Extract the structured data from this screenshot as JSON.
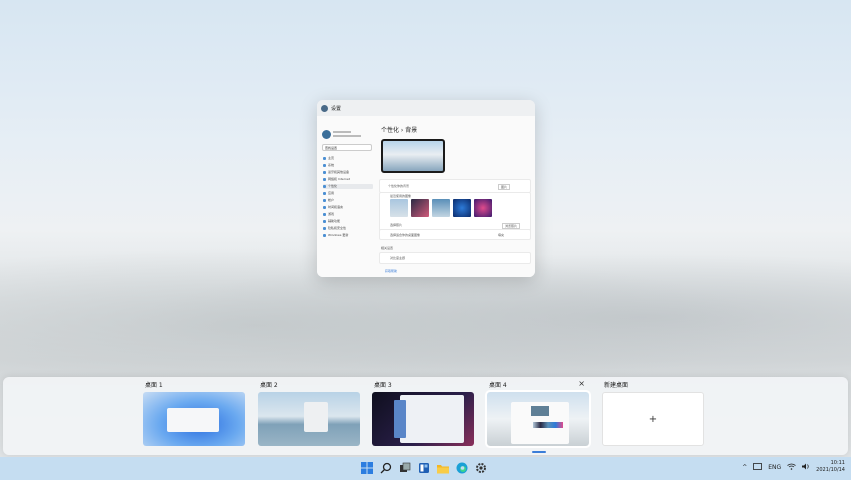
{
  "window": {
    "title": "设置",
    "breadcrumb": "个性化 › 背景",
    "sidebar": {
      "search_placeholder": "查找设置",
      "items": [
        "主页",
        "系统",
        "蓝牙和其他设备",
        "网络和 Internet",
        "个性化",
        "应用",
        "帐户",
        "时间和语言",
        "游戏",
        "辅助功能",
        "隐私和安全性",
        "Windows 更新"
      ]
    },
    "rows": {
      "personalize_bg": "个性化你的背景",
      "bg_value": "图片",
      "recent_images": "最近使用的图像",
      "choose_photo": "选择照片",
      "browse": "浏览照片",
      "fit": "选择适合你的桌面图像",
      "fit_value": "填充",
      "related": "相关设置",
      "contrast": "对比度主题",
      "help": "获取帮助"
    }
  },
  "desktops": [
    {
      "label": "桌面 1"
    },
    {
      "label": "桌面 2"
    },
    {
      "label": "桌面 3"
    },
    {
      "label": "桌面 4"
    },
    {
      "label": "新建桌面",
      "plus": "+"
    }
  ],
  "close_glyph": "×",
  "taskbar": {
    "icons": [
      "start-icon",
      "search-icon",
      "task-view-icon",
      "widgets-icon",
      "file-explorer-icon",
      "edge-icon",
      "settings-icon"
    ],
    "tray": {
      "chevron": "^",
      "lang": "ENG",
      "time": "10:11",
      "date": "2021/10/14"
    }
  },
  "colors": {
    "accent": "#3b7dd8",
    "taskbar": "#c5ddf1"
  }
}
